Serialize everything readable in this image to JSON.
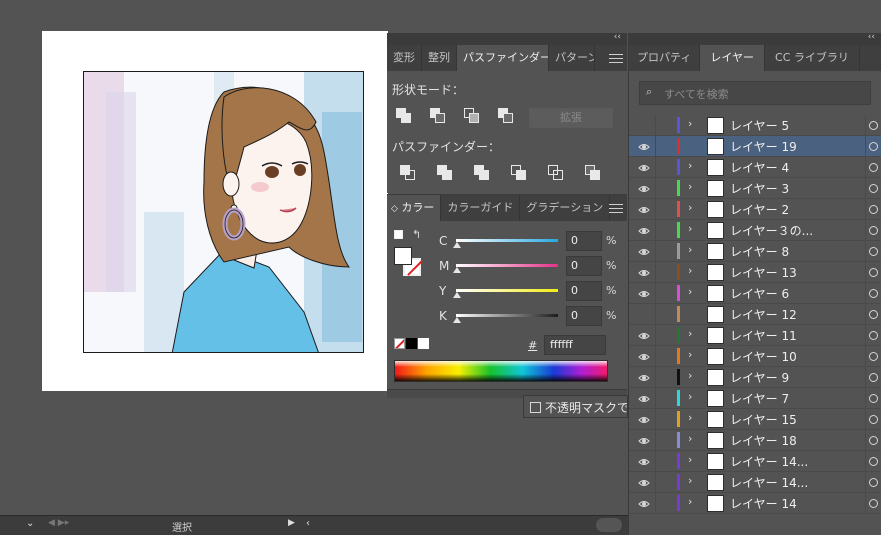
{
  "pathfinder_panel": {
    "tabs": [
      "変形",
      "整列",
      "パスファインダー",
      "パターン"
    ],
    "active_tab": "パスファインダー",
    "shape_modes_label": "形状モード：",
    "expand_label": "拡張",
    "pathfinders_label": "パスファインダー："
  },
  "color_panel": {
    "tabs": [
      "カラー",
      "カラーガイド",
      "グラデーション"
    ],
    "sliders": [
      {
        "label": "C",
        "value": "0",
        "unit": "%",
        "color": "#29a8e0"
      },
      {
        "label": "M",
        "value": "0",
        "unit": "%",
        "color": "#e6318a"
      },
      {
        "label": "Y",
        "value": "0",
        "unit": "%",
        "color": "#f2eb12"
      },
      {
        "label": "K",
        "value": "0",
        "unit": "%",
        "color": "#1c1c1c"
      }
    ],
    "hex_prefix": "#",
    "hex_value": "ffffff"
  },
  "opacity_mask_label": "不透明マスクで",
  "layers_panel": {
    "tabs": [
      "プロパティ",
      "レイヤー",
      "CC ライブラリ"
    ],
    "active_tab": "レイヤー",
    "search_placeholder": "すべてを検索",
    "layers": [
      {
        "name": "レイヤー 5",
        "color": "#5b55d8",
        "has_children": true,
        "visible": false,
        "selected": false
      },
      {
        "name": "レイヤー 19",
        "color": "#d83030",
        "has_children": false,
        "visible": true,
        "selected": true
      },
      {
        "name": "レイヤー 4",
        "color": "#5b55d8",
        "has_children": true,
        "visible": true,
        "selected": false
      },
      {
        "name": "レイヤー 3",
        "color": "#49d84f",
        "has_children": true,
        "visible": true,
        "selected": false
      },
      {
        "name": "レイヤー 2",
        "color": "#e05050",
        "has_children": true,
        "visible": true,
        "selected": false
      },
      {
        "name": "レイヤー３の...",
        "color": "#49d84f",
        "has_children": true,
        "visible": true,
        "selected": false
      },
      {
        "name": "レイヤー 8",
        "color": "#9a9a9a",
        "has_children": true,
        "visible": true,
        "selected": false
      },
      {
        "name": "レイヤー 13",
        "color": "#8a4f1f",
        "has_children": true,
        "visible": true,
        "selected": false
      },
      {
        "name": "レイヤー 6",
        "color": "#d84fd8",
        "has_children": true,
        "visible": true,
        "selected": false
      },
      {
        "name": "レイヤー 12",
        "color": "#c08a5a",
        "has_children": false,
        "visible": false,
        "selected": false
      },
      {
        "name": "レイヤー 11",
        "color": "#1f7a2f",
        "has_children": true,
        "visible": true,
        "selected": false
      },
      {
        "name": "レイヤー 10",
        "color": "#e07a1f",
        "has_children": true,
        "visible": true,
        "selected": false
      },
      {
        "name": "レイヤー 9",
        "color": "#111111",
        "has_children": true,
        "visible": true,
        "selected": false
      },
      {
        "name": "レイヤー 7",
        "color": "#2fd8d8",
        "has_children": true,
        "visible": true,
        "selected": false
      },
      {
        "name": "レイヤー 15",
        "color": "#e0a020",
        "has_children": true,
        "visible": true,
        "selected": false
      },
      {
        "name": "レイヤー 18",
        "color": "#8a8ad8",
        "has_children": true,
        "visible": true,
        "selected": false
      },
      {
        "name": "レイヤー 14...",
        "color": "#7a3ad8",
        "has_children": true,
        "visible": true,
        "selected": false
      },
      {
        "name": "レイヤー 14...",
        "color": "#7a3ad8",
        "has_children": true,
        "visible": true,
        "selected": false
      },
      {
        "name": "レイヤー 14",
        "color": "#7a3ad8",
        "has_children": true,
        "visible": true,
        "selected": false
      }
    ]
  },
  "status_bar": {
    "tool_label": "選択"
  }
}
